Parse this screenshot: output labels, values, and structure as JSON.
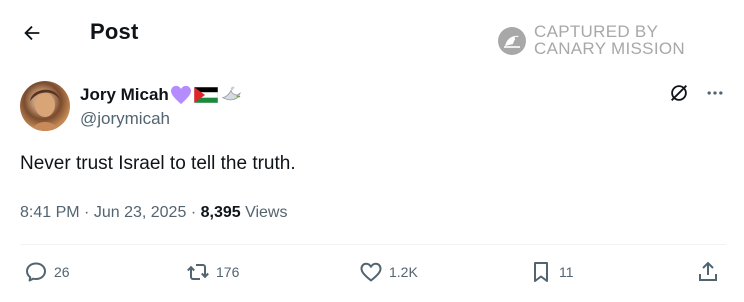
{
  "header": {
    "back_icon": "arrow-left-icon",
    "title": "Post"
  },
  "watermark": {
    "line1": "CAPTURED BY",
    "line2": "CANARY MISSION",
    "logo_icon": "canary-logo-icon"
  },
  "author": {
    "name": "Jory Micah",
    "emojis": [
      "purple-heart",
      "palestine-flag",
      "dove"
    ],
    "handle": "@jorymicah"
  },
  "tweet": {
    "text": "Never trust Israel to tell the truth."
  },
  "meta": {
    "time": "8:41 PM",
    "sep1": "·",
    "date": "Jun 23, 2025",
    "sep2": "·",
    "views_count": "8,395",
    "views_label": "Views"
  },
  "actions": {
    "replies": "26",
    "reposts": "176",
    "likes": "1.2K",
    "bookmarks": "11"
  },
  "colors": {
    "text": "#0f1419",
    "muted": "#536471",
    "watermark": "#a8a8a8",
    "divider": "#eff3f4",
    "heart_purple": "#b48cff"
  }
}
